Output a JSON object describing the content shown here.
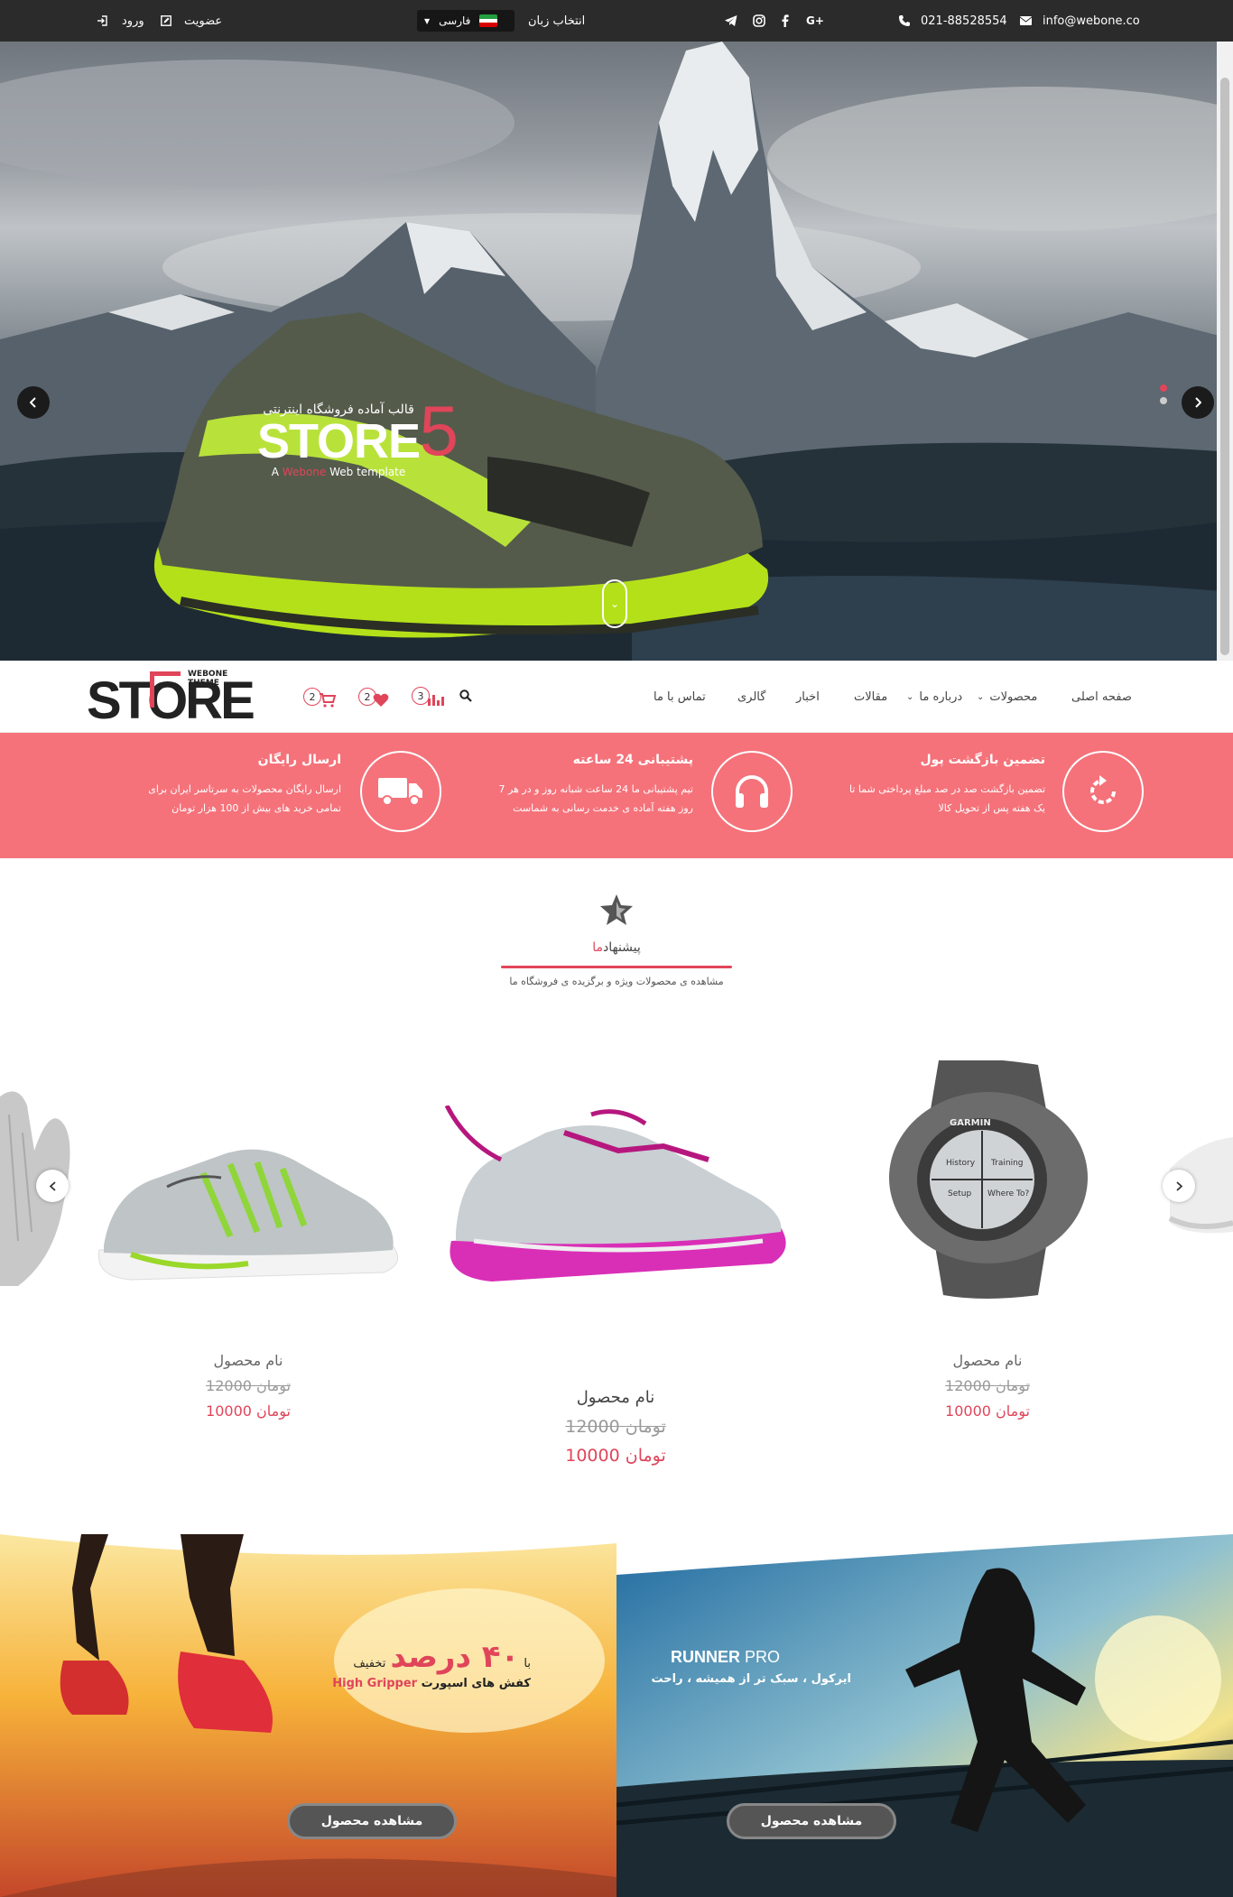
{
  "topbar": {
    "email": "info@webone.co",
    "phone": "021-88528554",
    "lang_label": "انتخاب زبان",
    "lang_selected": "فارسی",
    "register": "عضویت",
    "login": "ورود",
    "social": [
      "google-plus-icon",
      "facebook-icon",
      "instagram-icon",
      "telegram-icon"
    ]
  },
  "hero": {
    "subtitle": "قالب آماده فروشگاه اینترنتی",
    "logo_text": "STORE",
    "logo_num": "5",
    "tagline_a": "A ",
    "tagline_brand": "Webone",
    "tagline_b": " Web template"
  },
  "nav": {
    "brand_word": "STORE",
    "brand_theme": "WEBONE THEME",
    "items": [
      "صفحه اصلی",
      "محصولات",
      "درباره ما",
      "مقالات",
      "اخبار",
      "گالری",
      "تماس با ما"
    ],
    "compare_count": "3",
    "wishlist_count": "2",
    "cart_count": "2"
  },
  "features": [
    {
      "title": "تضمین بازگشت پول",
      "desc": "تضمین بازگشت صد در صد مبلغ پرداختی شما تا یک هفته پس از تحویل کالا",
      "icon": "refresh-icon"
    },
    {
      "title": "پشتیبانی 24 ساعته",
      "desc": "تیم پشتیبانی ما 24 ساعت شبانه روز و در هر 7 روز هفته آماده ی خدمت رسانی به شماست",
      "icon": "headphones-icon"
    },
    {
      "title": "ارسال رایگان",
      "desc": "ارسال رایگان محصولات به سرتاسر ایران برای تمامی خرید های بیش از 100 هزار تومان",
      "icon": "truck-icon"
    }
  ],
  "section": {
    "title_a": "پیشنهاد",
    "title_b": "ما",
    "subtitle": "مشاهده ی محصولات ویژه و برگزیده ی فروشگاه ما"
  },
  "products": [
    {
      "name": "نام محصول",
      "old_price": "12000",
      "old_unit": "تومان",
      "price": "10000",
      "unit": "تومان"
    },
    {
      "name": "نام محصول",
      "old_price": "12000",
      "old_unit": "تومان",
      "price": "10000",
      "unit": "تومان"
    },
    {
      "name": "نام محصول",
      "old_price": "12000",
      "old_unit": "تومان",
      "price": "10000",
      "unit": "تومان"
    }
  ],
  "banners": {
    "left": {
      "prefix": "با",
      "big": "۴۰ درصد",
      "suffix": "تخفیف",
      "line2": "کفش های اسپورت",
      "brand": "High Gripper",
      "button": "مشاهده محصول"
    },
    "right": {
      "title_a": "RUNNER",
      "title_b": " PRO",
      "line2": "ایرکول ، سبک تر از همیشه ، راحت",
      "button": "مشاهده محصول"
    }
  },
  "colors": {
    "accent": "#e0455a",
    "features_bg": "#f5727a",
    "topbar_bg": "#2b2b2b"
  }
}
